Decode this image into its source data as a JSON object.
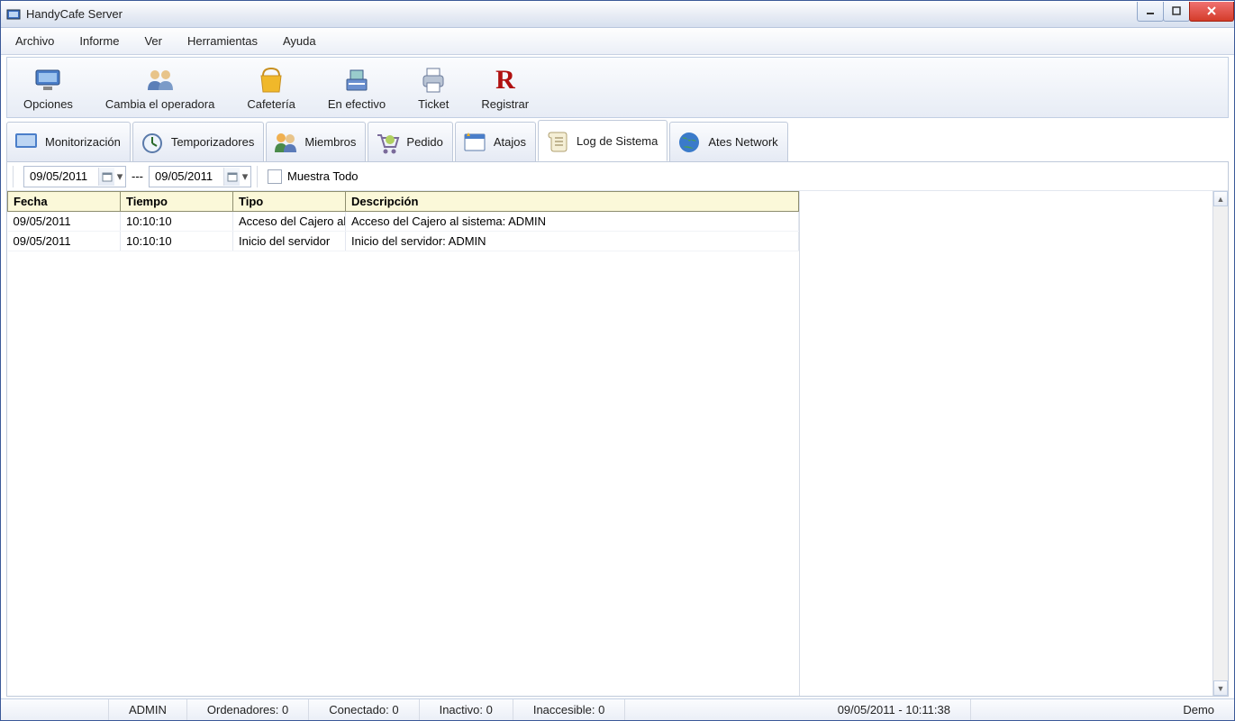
{
  "window": {
    "title": "HandyCafe Server"
  },
  "menu": {
    "items": [
      "Archivo",
      "Informe",
      "Ver",
      "Herramientas",
      "Ayuda"
    ]
  },
  "toolbar": {
    "items": [
      {
        "id": "opciones",
        "label": "Opciones"
      },
      {
        "id": "cambia",
        "label": "Cambia el operadora"
      },
      {
        "id": "cafeteria",
        "label": "Cafetería"
      },
      {
        "id": "efectivo",
        "label": "En efectivo"
      },
      {
        "id": "ticket",
        "label": "Ticket"
      },
      {
        "id": "registrar",
        "label": "Registrar"
      }
    ]
  },
  "tabs": {
    "items": [
      {
        "id": "monitor",
        "label": "Monitorización"
      },
      {
        "id": "tempor",
        "label": "Temporizadores"
      },
      {
        "id": "miembros",
        "label": "Miembros"
      },
      {
        "id": "pedido",
        "label": "Pedido"
      },
      {
        "id": "atajos",
        "label": "Atajos"
      },
      {
        "id": "log",
        "label": "Log de Sistema",
        "active": true
      },
      {
        "id": "ates",
        "label": "Ates Network"
      }
    ]
  },
  "filter": {
    "date_from": "09/05/2011",
    "date_to": "09/05/2011",
    "date_to_display_partial": "/05/2011",
    "date_to_display_prefix": "09",
    "separator": "---",
    "show_all_label": "Muestra Todo"
  },
  "table": {
    "columns": [
      "Fecha",
      "Tiempo",
      "Tipo",
      "Descripción"
    ],
    "rows": [
      {
        "fecha": "09/05/2011",
        "tiempo": "10:10:10",
        "tipo": "Acceso del Cajero al",
        "desc": "Acceso del Cajero al sistema: ADMIN"
      },
      {
        "fecha": "09/05/2011",
        "tiempo": "10:10:10",
        "tipo": "Inicio del servidor",
        "desc": "Inicio del servidor: ADMIN"
      }
    ]
  },
  "status": {
    "user": "ADMIN",
    "ordenadores": "Ordenadores: 0",
    "conectado": "Conectado: 0",
    "inactivo": "Inactivo: 0",
    "inaccesible": "Inaccesible: 0",
    "datetime": "09/05/2011 - 10:11:38",
    "mode": "Demo"
  }
}
